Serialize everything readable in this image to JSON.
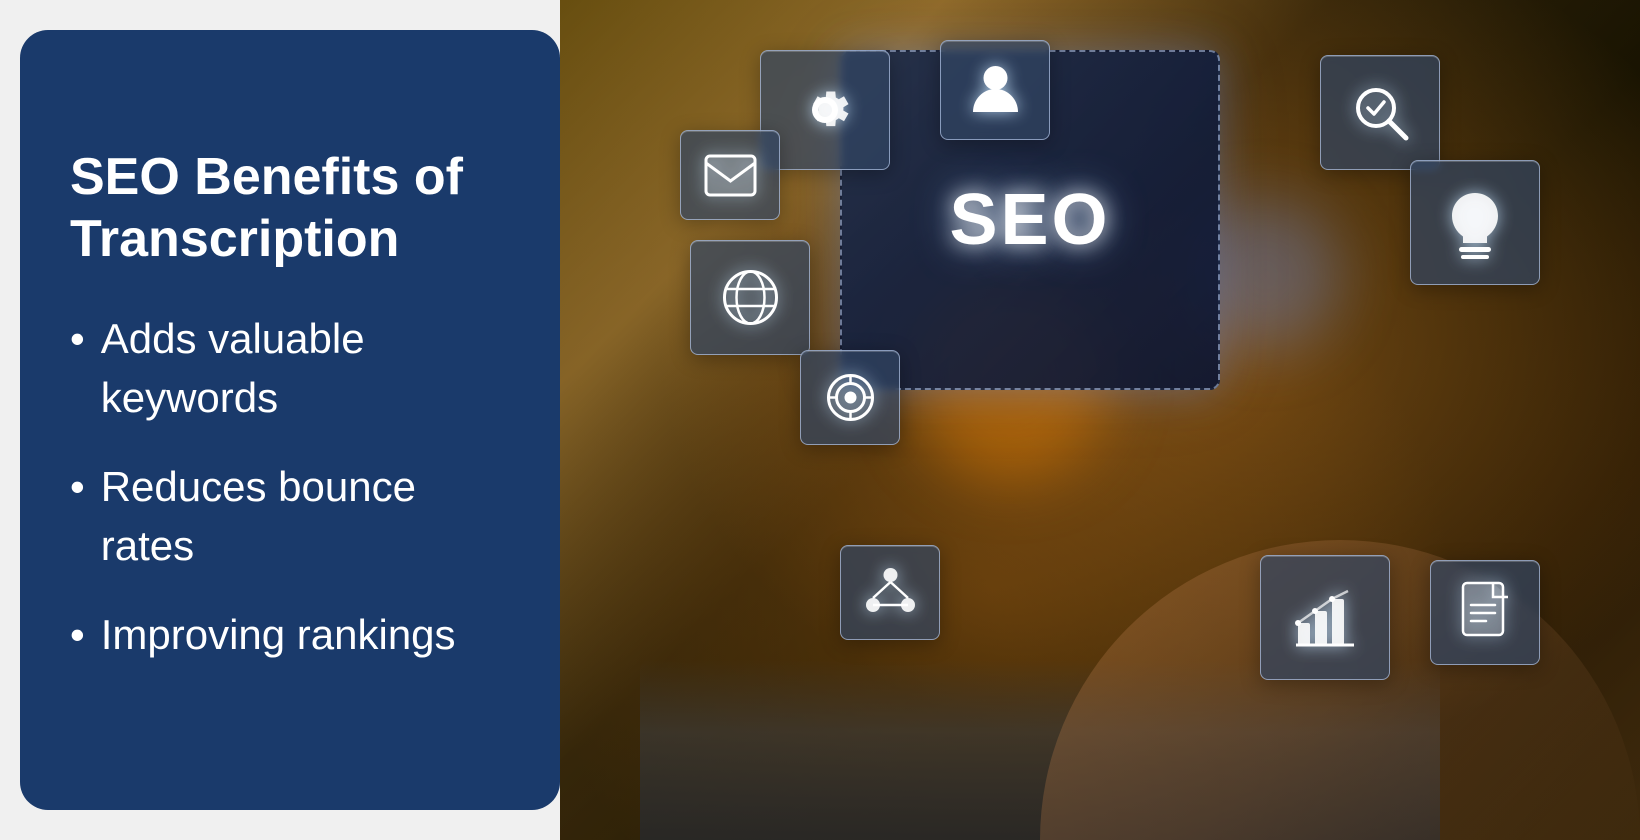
{
  "layout": {
    "bg_color": "#f0f2f5"
  },
  "left_panel": {
    "bg_color": "#1a3a6b",
    "title_line1": "SEO Benefits of",
    "title_line2": "Transcription",
    "bullet_items": [
      {
        "id": "bullet1",
        "text": "Adds valuable keywords"
      },
      {
        "id": "bullet2",
        "text": "Reduces bounce rates"
      },
      {
        "id": "bullet3",
        "text": "Improving rankings"
      }
    ],
    "bullet_char": "•"
  },
  "right_panel": {
    "seo_label": "SEO",
    "icons": {
      "gear": "⚙",
      "person": "👤",
      "email": "✉",
      "search": "🔍",
      "globe": "🌐",
      "target": "🎯",
      "lightbulb": "💡",
      "network": "🔗",
      "chart": "📊",
      "document": "📄"
    }
  }
}
